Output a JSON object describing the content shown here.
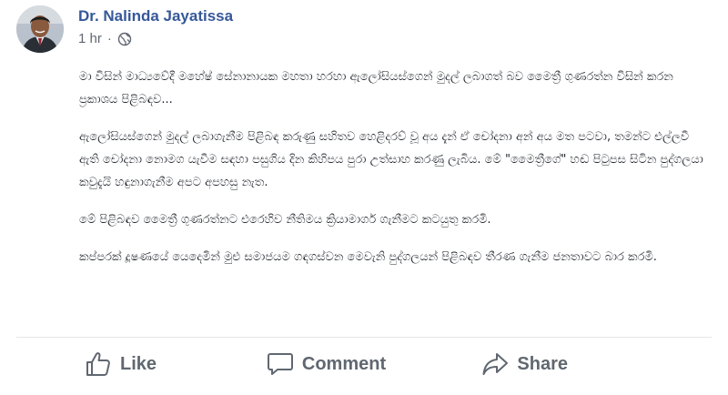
{
  "post": {
    "author": "Dr. Nalinda Jayatissa",
    "time": "1 hr",
    "separator": "·",
    "privacy_icon": "globe-icon",
    "paragraphs": [
      "මා විසින් මාධ්‍යවේදී මහේෂ් සේනානායක මහතා හරහා ඇලෝසියස්ගෙන් මුදල් ලබාගත් බව මෛත්‍රී ගුණරත්න විසින් කරන ප්‍රකාශය පිළිබඳව...",
      "ඇලෝසියස්ගෙන් මුදල් ලබාගැනීම පිළිබඳ කරුණු සහිතව හෙළිදරව් වූ අය දැන් ඒ චෝදනා අන් අය මත පටවා, තමන්ට එල්ලවී ඇති චෝදනා නොමග යැවීම සඳහා පසුගිය දින කිහිපය පුරා උත්සාහ කරණු ලැබිය. මේ \"මෛත්‍රීගේ\" හඬ පිටුපස සිටින පුද්ගලයා කවුදැයි හඳුනාගැනීම අපට අපහසු නැත.",
      "මේ පිළිබඳව මෛත්‍රී ගුණරත්නට එරෙහිව නීතිමය ක්‍රියාමාර්ග ගැනීමට කටයුතු කරමි.",
      "කප්පරක් දූෂණයේ යෙදෙමින් මුළු සමාජයම ගඳගස්වන මෙවැනි පුද්ගලයන් පිළිබඳව තීරණ ගැනීම ජනතාවට බාර කරමි."
    ]
  },
  "actions": {
    "like_label": "Like",
    "comment_label": "Comment",
    "share_label": "Share"
  },
  "colors": {
    "author_link": "#365899",
    "meta_text": "#616770",
    "action_text": "#606770",
    "divider": "#e5e6e9"
  }
}
